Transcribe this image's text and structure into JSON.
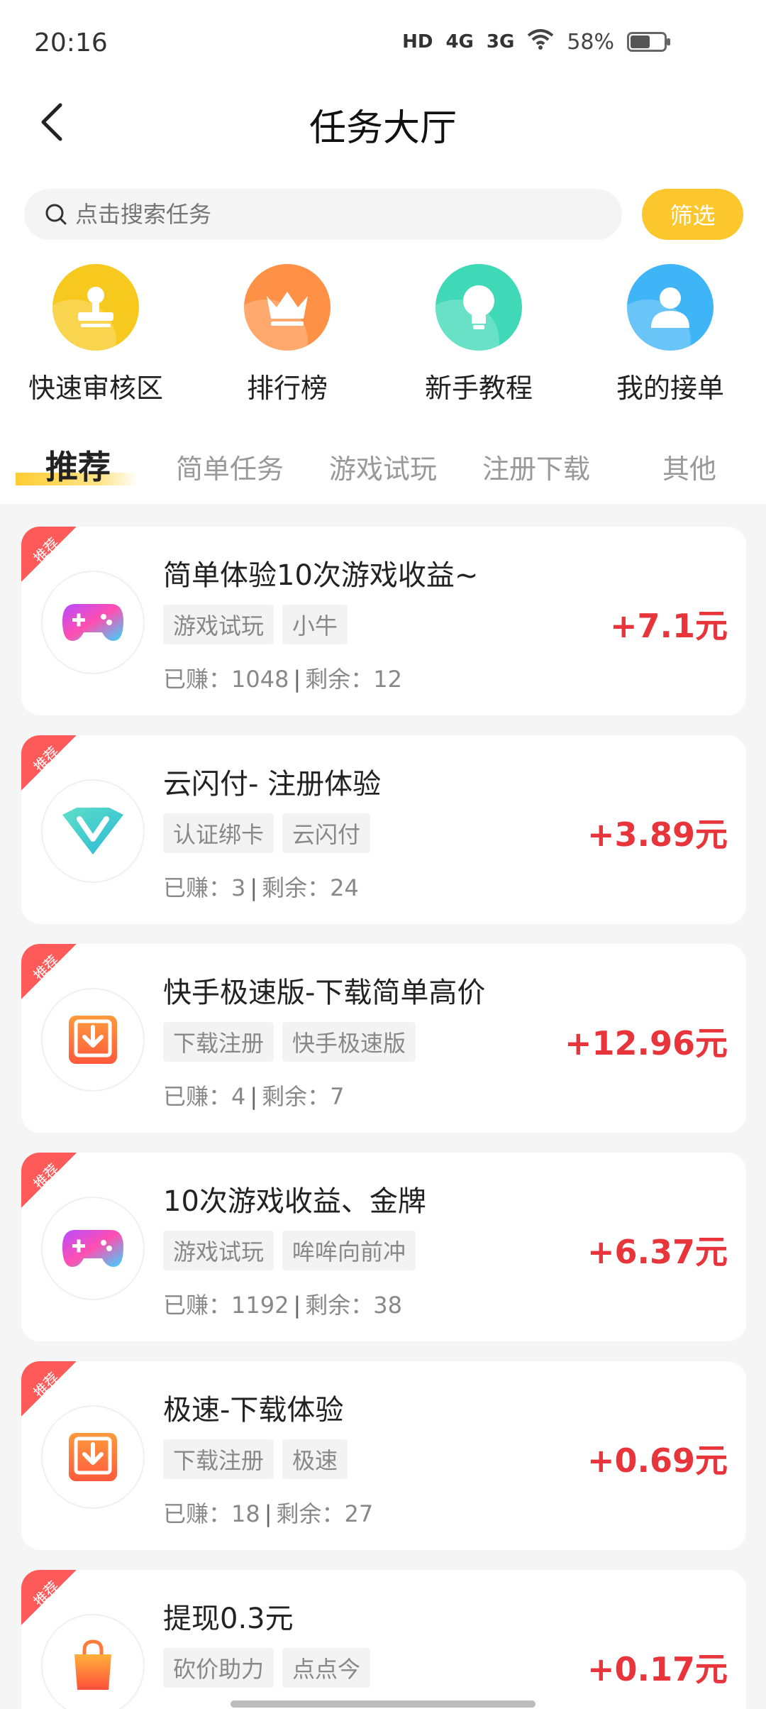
{
  "status_bar": {
    "time": "20:16",
    "hd": "HD",
    "net1": "4G",
    "net2": "3G",
    "battery": "58%",
    "battery_level": 0.58
  },
  "header": {
    "title": "任务大厅"
  },
  "search": {
    "placeholder": "点击搜索任务",
    "filter_label": "筛选"
  },
  "quick": [
    {
      "label": "快速审核区",
      "icon": "stamp-icon",
      "color": "#f7c81e"
    },
    {
      "label": "排行榜",
      "icon": "crown-icon",
      "color": "#ff9147"
    },
    {
      "label": "新手教程",
      "icon": "bulb-icon",
      "color": "#3fd9b8"
    },
    {
      "label": "我的接单",
      "icon": "user-icon",
      "color": "#3fb4f7"
    }
  ],
  "tabs": [
    "推荐",
    "简单任务",
    "游戏试玩",
    "注册下载",
    "其他"
  ],
  "badge": "推荐",
  "tasks": [
    {
      "title": "简单体验10次游戏收益~",
      "tags": [
        "游戏试玩",
        "小牛"
      ],
      "earned_label": "已赚：",
      "earned": "1048",
      "remain_label": "剩余：",
      "remain": "12",
      "reward": "+7.1元",
      "icon": "gamepad-icon"
    },
    {
      "title": "云闪付- 注册体验",
      "tags": [
        "认证绑卡",
        "云闪付"
      ],
      "earned_label": "已赚：",
      "earned": "3",
      "remain_label": "剩余：",
      "remain": "24",
      "reward": "+3.89元",
      "icon": "v-logo-icon"
    },
    {
      "title": "快手极速版-下载简单高价",
      "tags": [
        "下载注册",
        "快手极速版"
      ],
      "earned_label": "已赚：",
      "earned": "4",
      "remain_label": "剩余：",
      "remain": "7",
      "reward": "+12.96元",
      "icon": "download-icon"
    },
    {
      "title": "10次游戏收益、金牌",
      "tags": [
        "游戏试玩",
        "哞哞向前冲"
      ],
      "earned_label": "已赚：",
      "earned": "1192",
      "remain_label": "剩余：",
      "remain": "38",
      "reward": "+6.37元",
      "icon": "gamepad-icon"
    },
    {
      "title": "极速-下载体验",
      "tags": [
        "下载注册",
        "极速"
      ],
      "earned_label": "已赚：",
      "earned": "18",
      "remain_label": "剩余：",
      "remain": "27",
      "reward": "+0.69元",
      "icon": "download-icon"
    },
    {
      "title": "提现0.3元",
      "tags": [
        "砍价助力",
        "点点今"
      ],
      "earned_label": "",
      "earned": "",
      "remain_label": "",
      "remain": "",
      "reward": "+0.17元",
      "icon": "shopping-bag-icon"
    }
  ]
}
